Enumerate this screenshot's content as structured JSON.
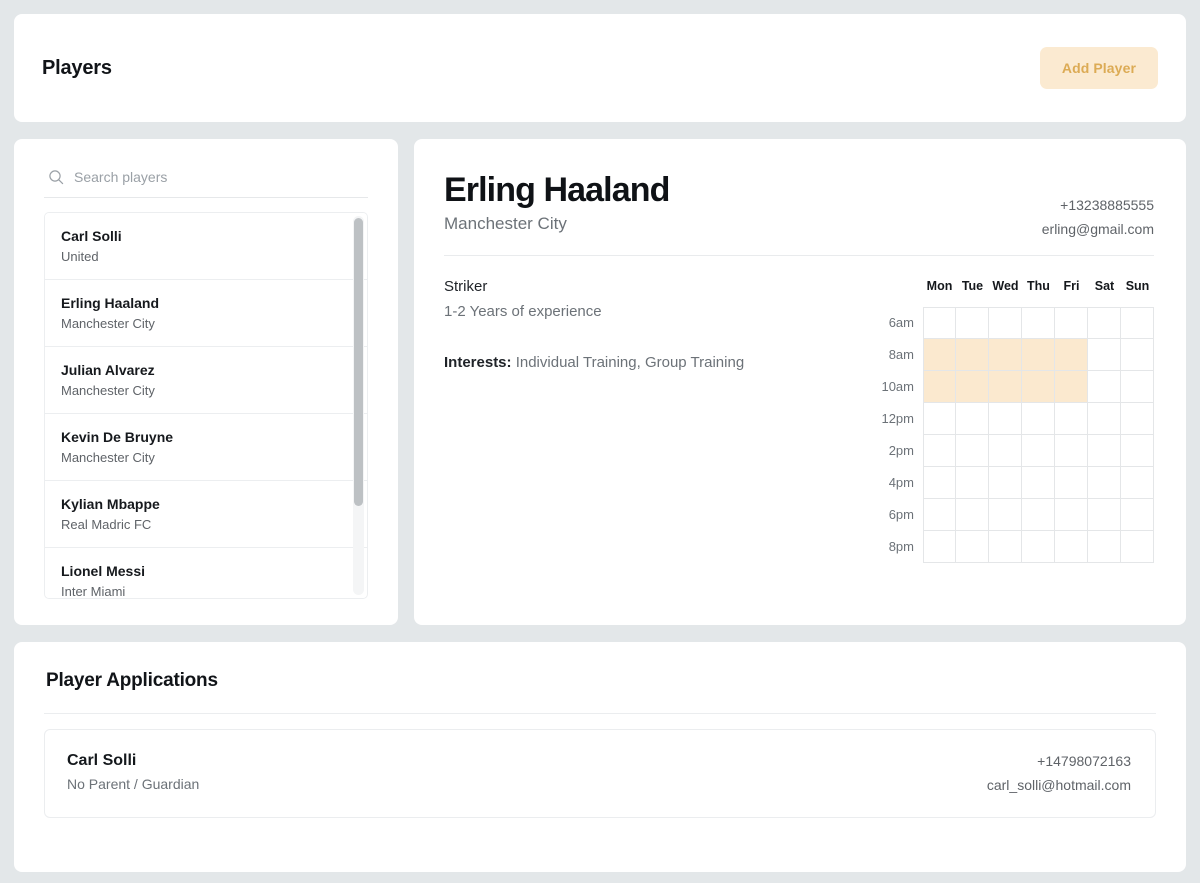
{
  "header": {
    "title": "Players",
    "add_button_label": "Add Player",
    "accent_bg": "#fbead1",
    "accent_text": "#dcab55"
  },
  "search": {
    "placeholder": "Search players",
    "value": "",
    "icon": "search-icon"
  },
  "players": [
    {
      "name": "Carl Solli",
      "team": "United"
    },
    {
      "name": "Erling Haaland",
      "team": "Manchester City"
    },
    {
      "name": "Julian Alvarez",
      "team": "Manchester City"
    },
    {
      "name": "Kevin De Bruyne",
      "team": "Manchester City"
    },
    {
      "name": "Kylian Mbappe",
      "team": "Real Madric FC"
    },
    {
      "name": "Lionel Messi",
      "team": "Inter Miami"
    }
  ],
  "detail": {
    "name": "Erling Haaland",
    "team": "Manchester City",
    "phone": "+13238885555",
    "email": "erling@gmail.com",
    "position": "Striker",
    "experience": "1-2 Years of experience",
    "interests_label": "Interests:",
    "interests_value": "Individual Training, Group Training"
  },
  "availability": {
    "days": [
      "Mon",
      "Tue",
      "Wed",
      "Thu",
      "Fri",
      "Sat",
      "Sun"
    ],
    "times": [
      "6am",
      "8am",
      "10am",
      "12pm",
      "2pm",
      "4pm",
      "6pm",
      "8pm"
    ],
    "selected_color": "#fbe9cf",
    "grid": [
      [
        0,
        0,
        0,
        0,
        0,
        0,
        0
      ],
      [
        1,
        1,
        1,
        1,
        1,
        0,
        0
      ],
      [
        1,
        1,
        1,
        1,
        1,
        0,
        0
      ],
      [
        0,
        0,
        0,
        0,
        0,
        0,
        0
      ],
      [
        0,
        0,
        0,
        0,
        0,
        0,
        0
      ],
      [
        0,
        0,
        0,
        0,
        0,
        0,
        0
      ],
      [
        0,
        0,
        0,
        0,
        0,
        0,
        0
      ],
      [
        0,
        0,
        0,
        0,
        0,
        0,
        0
      ]
    ]
  },
  "applications": {
    "title": "Player Applications",
    "rows": [
      {
        "name": "Carl Solli",
        "guardian": "No Parent / Guardian",
        "phone": "+14798072163",
        "email": "carl_solli@hotmail.com"
      }
    ]
  }
}
